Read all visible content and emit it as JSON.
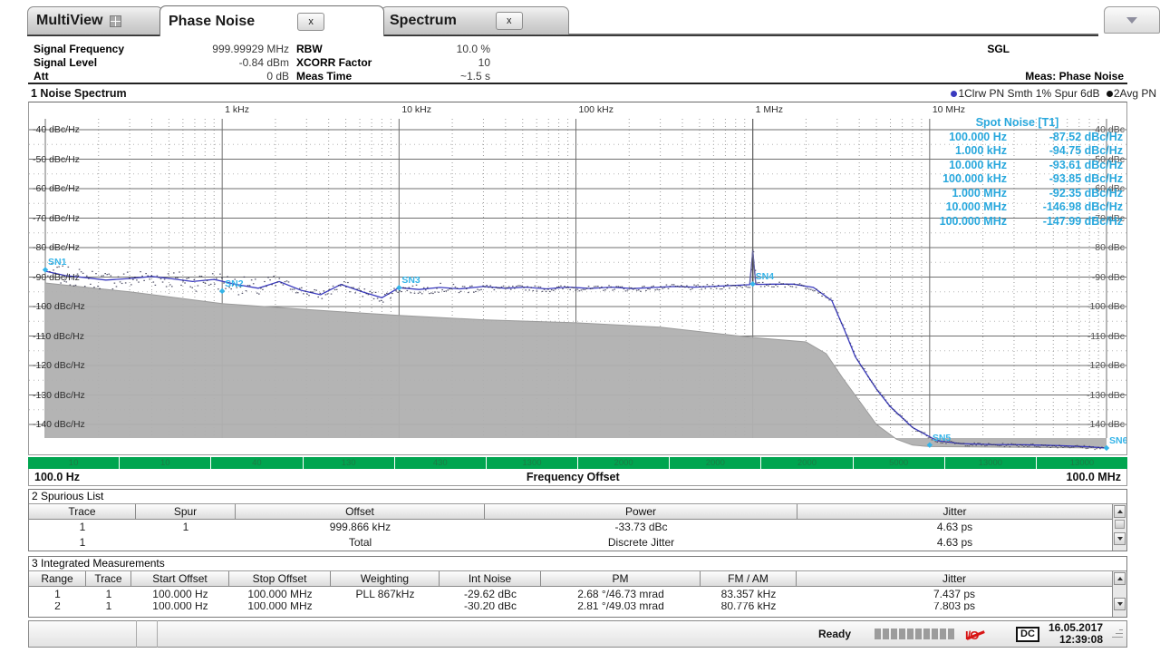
{
  "tabs": [
    {
      "label": "MultiView",
      "icon": "grid-icon",
      "active": false,
      "close": false
    },
    {
      "label": "Phase Noise",
      "active": true,
      "close": true,
      "close_label": "x"
    },
    {
      "label": "Spectrum",
      "active": false,
      "close": true,
      "close_label": "x"
    }
  ],
  "tabbar": {
    "dropdown_icon": "chevron-down-icon"
  },
  "header": {
    "params": [
      {
        "key": "Signal Frequency",
        "value": "999.99929 MHz"
      },
      {
        "key": "Signal Level",
        "value": "-0.84 dBm"
      },
      {
        "key": "Att",
        "value": "0 dB"
      }
    ],
    "params2": [
      {
        "key": "RBW",
        "value": "10.0 %"
      },
      {
        "key": "XCORR Factor",
        "value": "10"
      },
      {
        "key": "Meas Time",
        "value": "~1.5 s"
      }
    ],
    "sgl": "SGL",
    "meas": "Meas: Phase Noise"
  },
  "diagram": {
    "title": "1 Noise Spectrum",
    "legend": "1Clrw PN Smth 1% Spur 6dB 2Avg PN",
    "legend_trace1": "1Clrw PN Smth 1% Spur 6dB",
    "legend_trace2": "2Avg PN",
    "trace1_color": "#3b3bbf",
    "trace2_color": "#000000",
    "fill_color": "#b0b0b0",
    "marker_color": "#35b4e8",
    "spot_title": "Spot Noise [T1]",
    "markers": [
      "SN1",
      "SN2",
      "SN3",
      "SN4",
      "SN5",
      "SN6"
    ],
    "x_start": "100.0 Hz",
    "x_stop": "100.0 MHz",
    "x_axis_label": "Frequency Offset",
    "decade_labels": [
      "1 kHz",
      "10 kHz",
      "100 kHz",
      "1 MHz",
      "10 MHz"
    ],
    "y_labels": [
      "-40 dBc/Hz",
      "-50 dBc/Hz",
      "-60 dBc/Hz",
      "-70 dBc/Hz",
      "-80 dBc/Hz",
      "-90 dBc/Hz",
      "-100 dBc/Hz",
      "-110 dBc/Hz",
      "-120 dBc/Hz",
      "-130 dBc/Hz",
      "-140 dBc/Hz"
    ],
    "y_labels_right": [
      "-80 dBc",
      "-90 dBc",
      "-100 dBc",
      "-110 dBc",
      "-120 dBc",
      "-130 dBc",
      "-140 dBc"
    ],
    "y_labels_right_top": [
      "-40 dBc",
      "-50 dBc",
      "-60 dBc",
      "-70 dBc"
    ],
    "green_bar": [
      "10",
      "10",
      "40",
      "130",
      "430",
      "1300",
      "2000",
      "2000",
      "2000",
      "5000",
      "13000",
      "13000"
    ]
  },
  "chart_data": {
    "type": "line",
    "title": "1 Noise Spectrum",
    "xlabel": "Frequency Offset",
    "ylabel": "dBc/Hz",
    "xscale": "log",
    "xlim": [
      100,
      100000000
    ],
    "ylim": [
      -145,
      -35
    ],
    "grid": true,
    "legend": [
      "1Clrw PN Smth 1% Spur 6dB",
      "2Avg PN"
    ],
    "ticks_x": [
      1000,
      10000,
      100000,
      1000000,
      10000000
    ],
    "tick_labels_x": [
      "1 kHz",
      "10 kHz",
      "100 kHz",
      "1 MHz",
      "10 MHz"
    ],
    "ticks_y": [
      -40,
      -50,
      -60,
      -70,
      -80,
      -90,
      -100,
      -110,
      -120,
      -130,
      -140
    ],
    "annotations": [
      "SN1",
      "SN2",
      "SN3",
      "SN4",
      "SN5",
      "SN6"
    ],
    "series": [
      {
        "name": "1Clrw PN Smth 1% Spur 6dB",
        "color": "#3b3bbf",
        "x": [
          100,
          130,
          170,
          220,
          300,
          400,
          520,
          680,
          900,
          1200,
          1600,
          2100,
          2800,
          3600,
          4700,
          6200,
          8000,
          10000,
          13000,
          17000,
          22000,
          30000,
          40000,
          52000,
          68000,
          90000,
          120000,
          160000,
          210000,
          280000,
          360000,
          470000,
          620000,
          800000,
          960000,
          999866,
          1040000,
          1300000,
          1700000,
          2200000,
          2800000,
          3300000,
          3800000,
          4300000,
          5000000,
          6000000,
          8000000,
          11000000,
          15000000,
          22000000,
          35000000,
          55000000,
          80000000,
          100000000
        ],
        "y": [
          -88,
          -89.5,
          -90.2,
          -91,
          -90.5,
          -89.8,
          -90.6,
          -91.5,
          -90.8,
          -92.5,
          -93.8,
          -91.5,
          -94.5,
          -96,
          -92.5,
          -95,
          -97,
          -93.6,
          -94.2,
          -93.5,
          -94,
          -93.2,
          -93.8,
          -93.4,
          -94,
          -93.4,
          -93.85,
          -93.4,
          -93.9,
          -93.5,
          -93.2,
          -93.4,
          -93.1,
          -92.8,
          -92.6,
          -81.2,
          -92.5,
          -92.4,
          -92.4,
          -93.5,
          -98,
          -108,
          -117,
          -122,
          -128,
          -134,
          -141,
          -145.5,
          -146.5,
          -146.8,
          -146.9,
          -147.2,
          -147.6,
          -147.99
        ]
      },
      {
        "name": "2Avg PN",
        "color": "#b0b0b0",
        "fill": true,
        "x": [
          100,
          300,
          1000,
          3000,
          10000,
          30000,
          100000,
          300000,
          1000000,
          2000000,
          2600000,
          3200000,
          4000000,
          5000000,
          6500000,
          8000000,
          10000000,
          100000000
        ],
        "y": [
          -92,
          -95,
          -99,
          -101,
          -103,
          -104.5,
          -105.5,
          -107,
          -110.5,
          -112,
          -116,
          -124,
          -132,
          -140,
          -145,
          -147,
          -147.5,
          -148
        ]
      }
    ],
    "spot_noise": {
      "title": "Spot Noise [T1]",
      "unit": "dBc/Hz",
      "rows": [
        {
          "offset": "100.000 Hz",
          "value": "-87.52",
          "unit": "dBc/Hz"
        },
        {
          "offset": "1.000 kHz",
          "value": "-94.75",
          "unit": "dBc/Hz"
        },
        {
          "offset": "10.000 kHz",
          "value": "-93.61",
          "unit": "dBc/Hz"
        },
        {
          "offset": "100.000 kHz",
          "value": "-93.85",
          "unit": "dBc/Hz"
        },
        {
          "offset": "1.000 MHz",
          "value": "-92.35",
          "unit": "dBc/Hz"
        },
        {
          "offset": "10.000 MHz",
          "value": "-146.98",
          "unit": "dBc/Hz"
        },
        {
          "offset": "100.000 MHz",
          "value": "-147.99",
          "unit": "dBc/Hz"
        }
      ]
    }
  },
  "spurious": {
    "title": "2 Spurious List",
    "columns": [
      "Trace",
      "Spur",
      "Offset",
      "Power",
      "Jitter"
    ],
    "rows": [
      [
        "1",
        "1",
        "999.866 kHz",
        "-33.73 dBc",
        "4.63 ps"
      ],
      [
        "1",
        "",
        "Total",
        "Discrete Jitter",
        "4.63 ps"
      ]
    ]
  },
  "integrated": {
    "title": "3 Integrated Measurements",
    "columns": [
      "Range",
      "Trace",
      "Start Offset",
      "Stop Offset",
      "Weighting",
      "Int Noise",
      "PM",
      "FM / AM",
      "Jitter"
    ],
    "rows": [
      [
        "1",
        "1",
        "100.000 Hz",
        "100.000 MHz",
        "PLL 867kHz",
        "-29.62 dBc",
        "2.68 °/46.73 mrad",
        "83.357 kHz",
        "7.437 ps"
      ],
      [
        "2",
        "1",
        "100.000 Hz",
        "100.000 MHz",
        "",
        "-30.20 dBc",
        "2.81 °/49.03 mrad",
        "80.776 kHz",
        "7.803 ps"
      ]
    ]
  },
  "statusbar": {
    "status": "Ready",
    "progress_segments": 10,
    "no_icon": "io-disabled-icon",
    "coupling": "DC",
    "date": "16.05.2017",
    "time": "12:39:08"
  }
}
